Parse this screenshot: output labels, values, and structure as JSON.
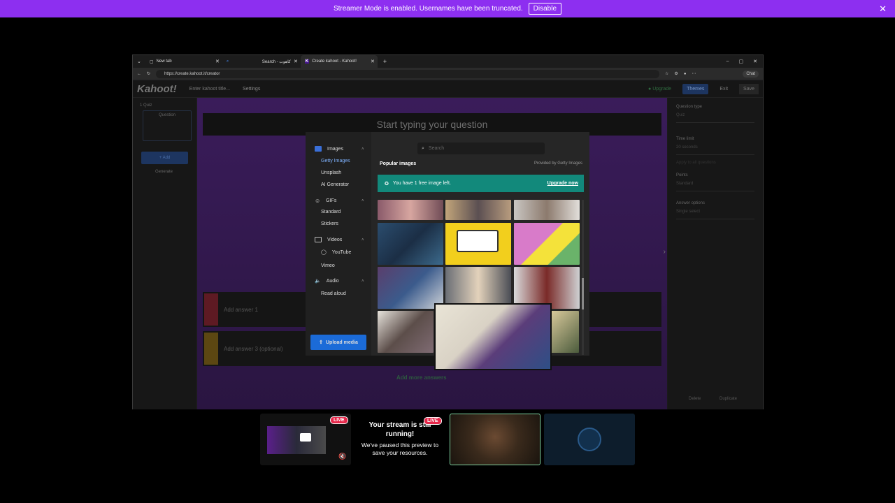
{
  "banner": {
    "message": "Streamer Mode is enabled. Usernames have been truncated.",
    "disable_label": "Disable"
  },
  "browser": {
    "tabs": [
      {
        "label": "New tab"
      },
      {
        "label": "Search - كاهوت"
      },
      {
        "label": "Create kahoot - Kahoot!"
      }
    ],
    "url": "https://create.kahoot.it/creator",
    "chat_label": "Chat"
  },
  "kahoot": {
    "logo": "Kahoot!",
    "title_placeholder": "Enter kahoot title...",
    "settings_label": "Settings",
    "upgrade_label": "Upgrade",
    "themes_label": "Themes",
    "exit_label": "Exit",
    "save_label": "Save",
    "slide_label": "1 Quiz",
    "slide_title": "Question",
    "add_label": "+ Add",
    "generate_label": "Generate",
    "question_placeholder": "Start typing your question",
    "answers": [
      {
        "placeholder": "Add answer 1",
        "color": "#e21b3c"
      },
      {
        "placeholder": "Add answer 3 (optional)",
        "color": "#d89e00"
      }
    ],
    "add_more_answers": "Add more answers",
    "right": {
      "question_type_label": "Question type",
      "question_type_value": "Quiz",
      "time_limit_label": "Time limit",
      "time_limit_value": "20 seconds",
      "apply_all": "Apply to all questions",
      "points_label": "Points",
      "points_value": "Standard",
      "answer_options_label": "Answer options",
      "answer_options_value": "Single select",
      "delete_label": "Delete",
      "duplicate_label": "Duplicate"
    }
  },
  "media_modal": {
    "nav": {
      "images": "Images",
      "getty": "Getty Images",
      "unsplash": "Unsplash",
      "ai_generator": "AI Generator",
      "gifs": "GIFs",
      "standard": "Standard",
      "stickers": "Stickers",
      "videos": "Videos",
      "youtube": "YouTube",
      "vimeo": "Vimeo",
      "audio": "Audio",
      "read_aloud": "Read aloud"
    },
    "upload_label": "Upload media",
    "search_placeholder": "Search",
    "popular_label": "Popular images",
    "provided_label": "Provided by Getty Images",
    "notice_text": "You have 1 free image left.",
    "upgrade_now": "Upgrade now"
  },
  "stream": {
    "live_label": "LIVE",
    "paused_title": "Your stream is still running!",
    "paused_sub": "We've paused this preview to save your resources."
  }
}
